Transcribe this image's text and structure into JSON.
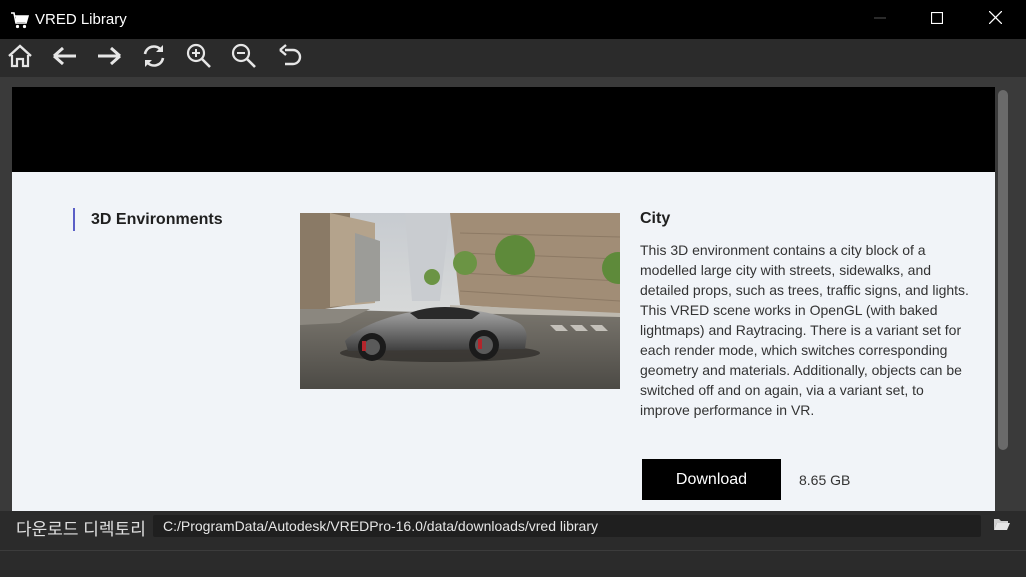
{
  "window": {
    "title": "VRED Library",
    "controls": [
      "minimize-icon",
      "maximize-icon",
      "close-icon"
    ]
  },
  "toolbar": {
    "buttons": [
      {
        "name": "home-icon"
      },
      {
        "name": "back-arrow-icon"
      },
      {
        "name": "forward-arrow-icon"
      },
      {
        "name": "refresh-icon"
      },
      {
        "name": "zoom-in-icon"
      },
      {
        "name": "zoom-out-icon"
      },
      {
        "name": "undo-icon"
      }
    ]
  },
  "content": {
    "category": "3D Environments",
    "item": {
      "title": "City",
      "description": "This 3D environment contains a city block of a modelled large city with streets, sidewalks, and detailed props, such as trees, traffic signs, and lights. This VRED scene works in OpenGL (with baked lightmaps) and Raytracing. There is a variant set for each render mode, which switches corresponding geometry and materials. Additionally, objects can be switched off and on again, via a variant set, to improve performance in VR.",
      "download_label": "Download",
      "size": "8.65 GB"
    }
  },
  "footer": {
    "directory_label": "다운로드 디렉토리",
    "directory_value": "C:/ProgramData/Autodesk/VREDPro-16.0/data/downloads/vred library",
    "folder_icon": "folder-open-icon"
  },
  "colors": {
    "titlebar": "#000000",
    "toolbar": "#2b2b2b",
    "page_bg": "#f1f4f8",
    "accent": "#5b5fc7",
    "button_bg": "#000000"
  }
}
